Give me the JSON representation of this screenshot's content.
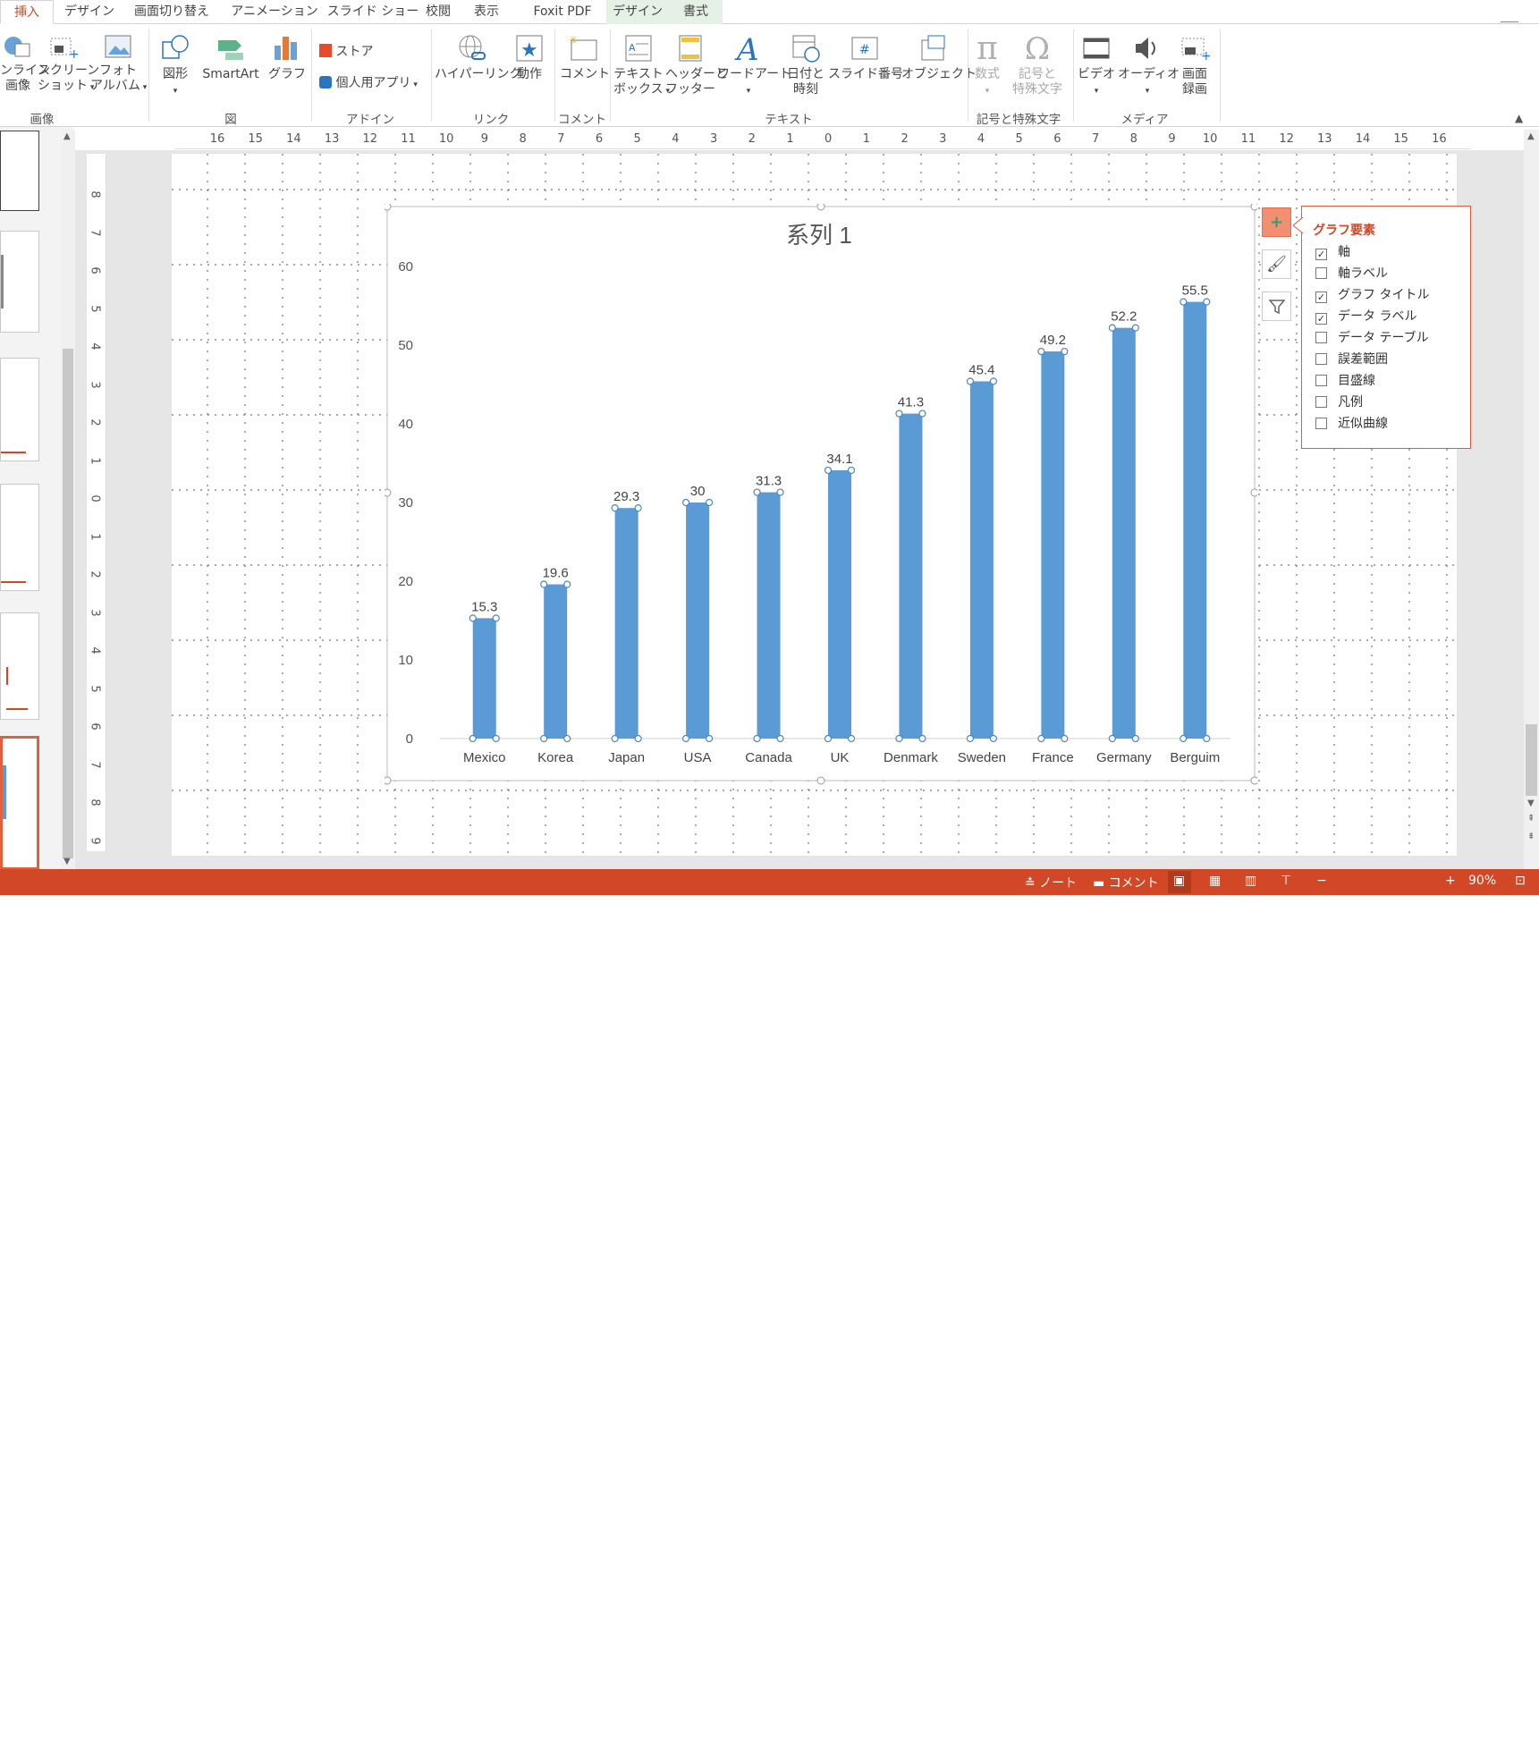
{
  "tabs": [
    {
      "label": "挿入",
      "active": true
    },
    {
      "label": "デザイン"
    },
    {
      "label": "画面切り替え"
    },
    {
      "label": "アニメーション"
    },
    {
      "label": "スライド ショー"
    },
    {
      "label": "校閲"
    },
    {
      "label": "表示"
    },
    {
      "label": "Foxit PDF"
    },
    {
      "label": "デザイン",
      "contextual": true
    },
    {
      "label": "書式",
      "contextual": true
    }
  ],
  "ribbon": {
    "images": {
      "online_l1": "ンライン",
      "online_l2": "画像",
      "screenshot_l1": "スクリーン",
      "screenshot_l2": "ショット",
      "album_l1": "フォト",
      "album_l2": "アルバム",
      "group": "画像"
    },
    "illustrations": {
      "shapes": "図形",
      "smartart": "SmartArt",
      "chart": "グラフ",
      "group": "図"
    },
    "addins": {
      "store": "ストア",
      "myapps": "個人用アプリ",
      "group": "アドイン"
    },
    "links": {
      "hyperlink": "ハイパーリンク",
      "action": "動作",
      "group": "リンク"
    },
    "comments": {
      "comment": "コメント",
      "group": "コメント"
    },
    "text": {
      "textbox_l1": "テキスト",
      "textbox_l2": "ボックス",
      "headerfooter_l1": "ヘッダーと",
      "headerfooter_l2": "フッター",
      "wordart": "ワードアート",
      "datetime_l1": "日付と",
      "datetime_l2": "時刻",
      "slidenum": "スライド番号",
      "object": "オブジェクト",
      "group": "テキスト"
    },
    "symbols": {
      "equation": "数式",
      "symbol_l1": "記号と",
      "symbol_l2": "特殊文字",
      "group": "記号と特殊文字"
    },
    "media": {
      "video": "ビデオ",
      "audio": "オーディオ",
      "screenrec_l1": "画面",
      "screenrec_l2": "録画",
      "group": "メディア"
    }
  },
  "hruler": [
    "16",
    "15",
    "14",
    "13",
    "12",
    "11",
    "10",
    "9",
    "8",
    "7",
    "6",
    "5",
    "4",
    "3",
    "2",
    "1",
    "0",
    "1",
    "2",
    "3",
    "4",
    "5",
    "6",
    "7",
    "8",
    "9",
    "10",
    "11",
    "12",
    "13",
    "14",
    "15",
    "16"
  ],
  "vruler": [
    "8",
    "7",
    "6",
    "5",
    "4",
    "3",
    "2",
    "1",
    "0",
    "1",
    "2",
    "3",
    "4",
    "5",
    "6",
    "7",
    "8",
    "9"
  ],
  "chart_panel": {
    "title": "グラフ要素",
    "items": [
      {
        "label": "軸",
        "checked": true
      },
      {
        "label": "軸ラベル",
        "checked": false
      },
      {
        "label": "グラフ タイトル",
        "checked": true
      },
      {
        "label": "データ ラベル",
        "checked": true
      },
      {
        "label": "データ テーブル",
        "checked": false
      },
      {
        "label": "誤差範囲",
        "checked": false
      },
      {
        "label": "目盛線",
        "checked": false
      },
      {
        "label": "凡例",
        "checked": false
      },
      {
        "label": "近似曲線",
        "checked": false
      }
    ]
  },
  "chart_data": {
    "type": "bar",
    "title": "系列 1",
    "categories": [
      "Mexico",
      "Korea",
      "Japan",
      "USA",
      "Canada",
      "UK",
      "Denmark",
      "Sweden",
      "France",
      "Germany",
      "Berguim"
    ],
    "values": [
      15.3,
      19.6,
      29.3,
      30,
      31.3,
      34.1,
      41.3,
      45.4,
      49.2,
      52.2,
      55.5
    ],
    "value_labels": [
      "15.3",
      "19.6",
      "29.3",
      "30",
      "31.3",
      "34.1",
      "41.3",
      "45.4",
      "49.2",
      "52.2",
      "55.5"
    ],
    "yticks": [
      "0",
      "10",
      "20",
      "30",
      "40",
      "50",
      "60"
    ],
    "ylim": [
      0,
      60
    ],
    "bar_color": "#5b9bd5",
    "grid": false,
    "legend": "none"
  },
  "status": {
    "notes": "ノート",
    "comments": "コメント",
    "zoom": "90%"
  },
  "colors": {
    "accent": "#d24726",
    "panel_border": "#e05a3a",
    "plus_button": "#f09070"
  }
}
